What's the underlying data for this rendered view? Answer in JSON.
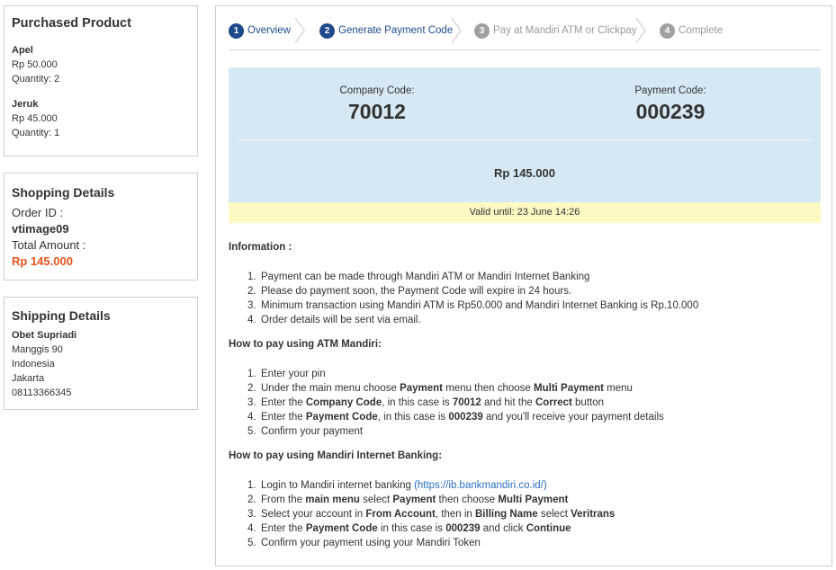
{
  "purchased": {
    "title": "Purchased Product",
    "items": [
      {
        "name": "Apel",
        "price": "Rp 50.000",
        "quantity": "Quantity: 2"
      },
      {
        "name": "Jeruk",
        "price": "Rp 45.000",
        "quantity": "Quantity: 1"
      }
    ]
  },
  "shopping": {
    "title": "Shopping Details",
    "order_label": "Order ID :",
    "order_id": "vtimage09",
    "total_label": "Total Amount :",
    "total": "Rp 145.000",
    "total_color": "#e8521d"
  },
  "shipping": {
    "title": "Shipping Details",
    "name": "Obet Supriadi",
    "address": "Manggis 90",
    "country": "Indonesia",
    "city": "Jakarta",
    "phone": "08113366345"
  },
  "steps": [
    {
      "num": "1",
      "label": "Overview",
      "state": "active"
    },
    {
      "num": "2",
      "label": "Generate Payment Code",
      "state": "active"
    },
    {
      "num": "3",
      "label": "Pay at Mandiri ATM or Clickpay",
      "state": "inactive"
    },
    {
      "num": "4",
      "label": "Complete",
      "state": "inactive"
    }
  ],
  "codes": {
    "company_label": "Company Code:",
    "company_code": "70012",
    "payment_label": "Payment Code:",
    "payment_code": "000239",
    "amount": "Rp 145.000",
    "valid_until": "Valid until: 23 June 14:26",
    "box_color": "#d5e8f4",
    "valid_color": "#fdf9c3"
  },
  "information": {
    "title": "Information :",
    "items": [
      "Payment can be made through Mandiri ATM or Mandiri Internet Banking",
      "Please do payment soon, the Payment Code will expire in 24 hours.",
      "Minimum transaction using Mandiri ATM is Rp50.000 and Mandiri Internet Banking is Rp.10.000",
      "Order details will be sent via email."
    ]
  },
  "atm": {
    "title": "How to pay using ATM Mandiri:",
    "i1": "Enter your pin",
    "i2_a": "Under the main menu choose ",
    "i2_b": "Payment",
    "i2_c": " menu then choose ",
    "i2_d": "Multi Payment",
    "i2_e": " menu",
    "i3_a": "Enter the ",
    "i3_b": "Company Code",
    "i3_c": ", in this case is ",
    "i3_d": "70012",
    "i3_e": " and hit the ",
    "i3_f": "Correct",
    "i3_g": " button",
    "i4_a": "Enter the ",
    "i4_b": "Payment Code",
    "i4_c": ", in this case is ",
    "i4_d": "000239",
    "i4_e": " and you'll receive your payment details",
    "i5": "Confirm your payment"
  },
  "ib": {
    "title": "How to pay using Mandiri Internet Banking:",
    "i1_a": "Login to Mandiri internet banking ",
    "i1_link": "(https://ib.bankmandiri.co.id/)",
    "i2_a": "From the ",
    "i2_b": "main menu",
    "i2_c": " select ",
    "i2_d": "Payment",
    "i2_e": " then choose ",
    "i2_f": "Multi Payment",
    "i3_a": "Select your account in ",
    "i3_b": "From Account",
    "i3_c": ", then in ",
    "i3_d": "Billing Name",
    "i3_e": " select ",
    "i3_f": "Veritrans",
    "i4_a": "Enter the ",
    "i4_b": "Payment Code",
    "i4_c": " in this case is ",
    "i4_d": "000239",
    "i4_e": " and click ",
    "i4_f": "Continue",
    "i5": "Confirm your payment using your Mandiri Token"
  },
  "numbers": [
    "1.",
    "2.",
    "3.",
    "4.",
    "5."
  ]
}
